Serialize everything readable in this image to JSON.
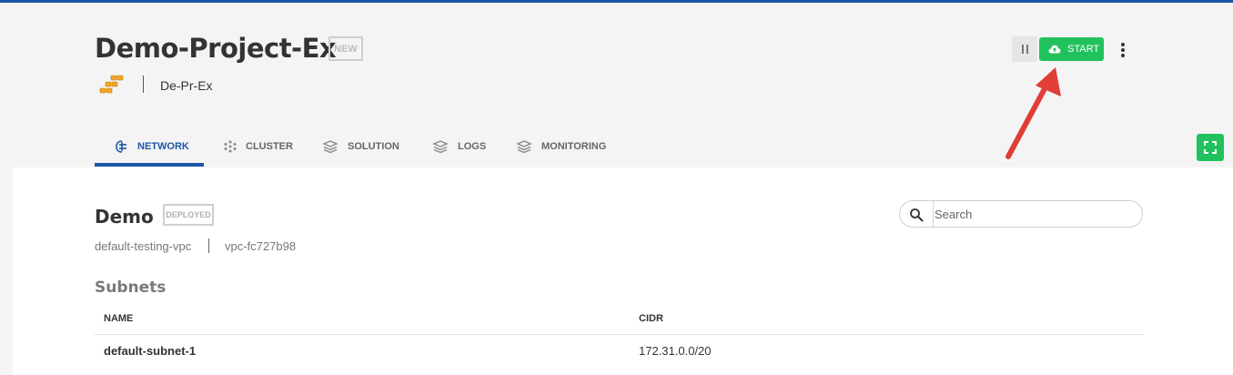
{
  "project": {
    "title": "Demo-Project-Ex",
    "status_badge": "NEW",
    "provider_icon": "aws-icon",
    "short_name": "De-Pr-Ex"
  },
  "actions": {
    "pause_icon": "pause-icon",
    "start_label": "START",
    "start_icon": "cloud-upload-icon",
    "more_icon": "more-vertical-icon"
  },
  "tabs": [
    {
      "label": "NETWORK",
      "icon": "network-icon",
      "active": true
    },
    {
      "label": "CLUSTER",
      "icon": "cluster-icon",
      "active": false
    },
    {
      "label": "SOLUTION",
      "icon": "solution-icon",
      "active": false
    },
    {
      "label": "LOGS",
      "icon": "logs-icon",
      "active": false
    },
    {
      "label": "MONITORING",
      "icon": "monitoring-icon",
      "active": false
    }
  ],
  "vpc": {
    "title": "Demo",
    "status_badge": "DEPLOYED",
    "name": "default-testing-vpc",
    "id": "vpc-fc727b98"
  },
  "search": {
    "placeholder": "Search",
    "value": ""
  },
  "subnets": {
    "title": "Subnets",
    "columns": [
      "NAME",
      "CIDR"
    ],
    "rows": [
      {
        "name": "default-subnet-1",
        "cidr": "172.31.0.0/20"
      }
    ]
  },
  "colors": {
    "accent": "#1e56a8",
    "start_green": "#21c25e",
    "annotation_arrow": "#e03e36"
  }
}
